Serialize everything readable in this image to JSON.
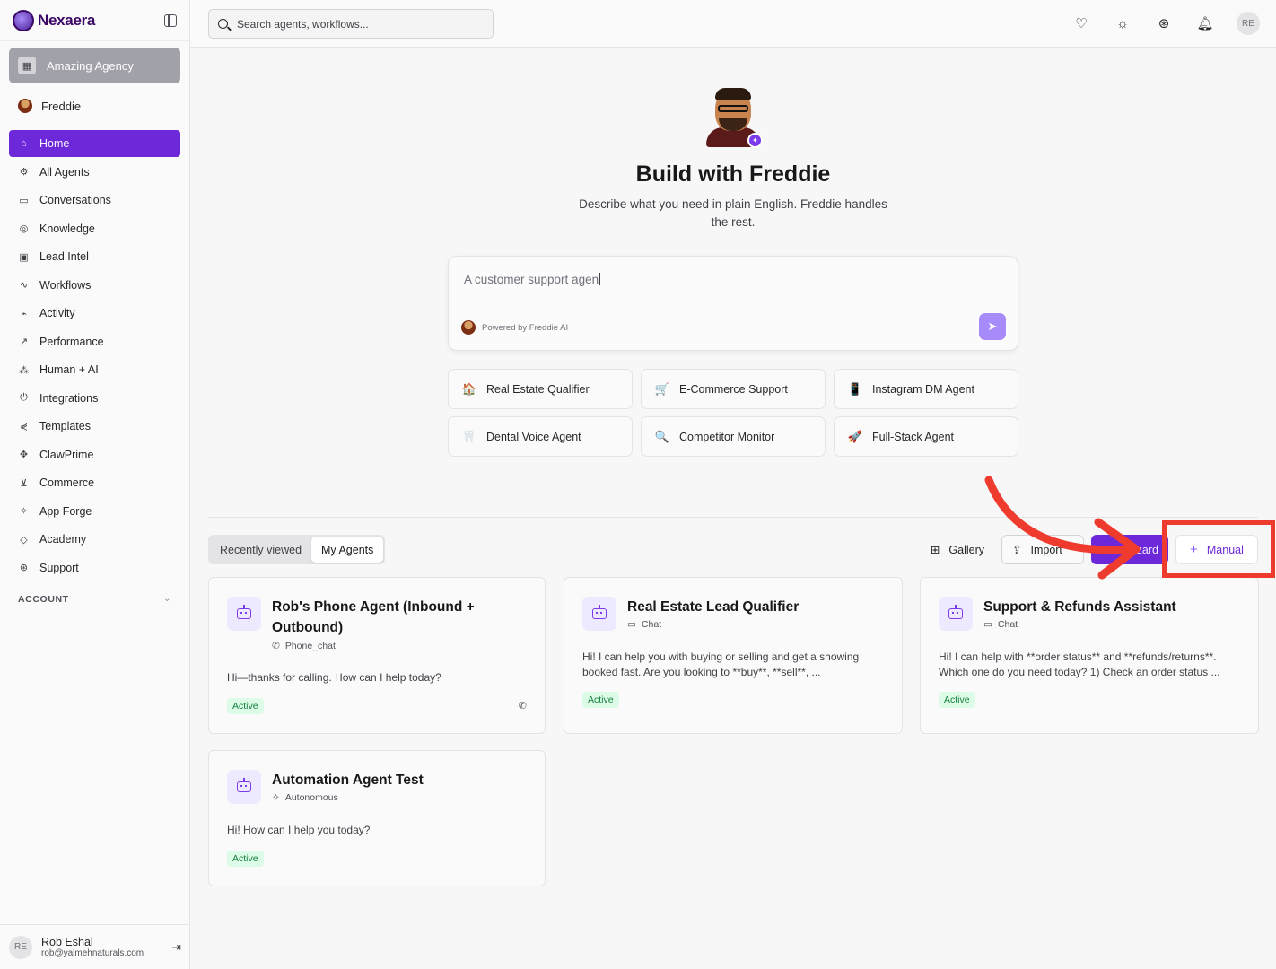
{
  "app": {
    "name": "Nexaera"
  },
  "sidebar": {
    "agency": "Amazing Agency",
    "user": "Freddie",
    "items": [
      {
        "label": "Home",
        "icon": "home-icon",
        "glyph": "⌂"
      },
      {
        "label": "All Agents",
        "icon": "robot-icon",
        "glyph": "⚙"
      },
      {
        "label": "Conversations",
        "icon": "chat-icon",
        "glyph": "▭"
      },
      {
        "label": "Knowledge",
        "icon": "brain-icon",
        "glyph": "◎"
      },
      {
        "label": "Lead Intel",
        "icon": "contact-icon",
        "glyph": "▣"
      },
      {
        "label": "Workflows",
        "icon": "workflow-icon",
        "glyph": "∿"
      },
      {
        "label": "Activity",
        "icon": "pulse-icon",
        "glyph": "⌁"
      },
      {
        "label": "Performance",
        "icon": "trend-icon",
        "glyph": "↗"
      },
      {
        "label": "Human + AI",
        "icon": "network-icon",
        "glyph": "⁂"
      },
      {
        "label": "Integrations",
        "icon": "plug-icon",
        "glyph": "⏻"
      },
      {
        "label": "Templates",
        "icon": "share-icon",
        "glyph": "⋞"
      },
      {
        "label": "ClawPrime",
        "icon": "paw-icon",
        "glyph": "✥"
      },
      {
        "label": "Commerce",
        "icon": "cart-icon",
        "glyph": "⊻"
      },
      {
        "label": "App Forge",
        "icon": "sparkles-icon",
        "glyph": "✧"
      },
      {
        "label": "Academy",
        "icon": "graduation-icon",
        "glyph": "◇"
      },
      {
        "label": "Support",
        "icon": "lifebuoy-icon",
        "glyph": "⊛"
      }
    ],
    "account_label": "ACCOUNT",
    "profile": {
      "initials": "RE",
      "name": "Rob Eshal",
      "email": "rob@yalmehnaturals.com"
    }
  },
  "topbar": {
    "search_placeholder": "Search agents, workflows...",
    "avatar_initials": "RE"
  },
  "hero": {
    "title": "Build with Freddie",
    "subtitle": "Describe what you need in plain English. Freddie handles the rest.",
    "prompt_value": "A customer support agen",
    "powered_by": "Powered by Freddie AI"
  },
  "chips": [
    {
      "label": "Real Estate Qualifier",
      "glyph": "🏠"
    },
    {
      "label": "E-Commerce Support",
      "glyph": "🛒"
    },
    {
      "label": "Instagram DM Agent",
      "glyph": "📱"
    },
    {
      "label": "Dental Voice Agent",
      "glyph": "🦷"
    },
    {
      "label": "Competitor Monitor",
      "glyph": "🔍"
    },
    {
      "label": "Full-Stack Agent",
      "glyph": "🚀"
    }
  ],
  "tabs": {
    "recent": "Recently viewed",
    "mine": "My Agents"
  },
  "actions": {
    "gallery": "Gallery",
    "import": "Import",
    "wizard": "Wizard",
    "manual": "Manual"
  },
  "cards": [
    {
      "title": "Rob's Phone Agent (Inbound + Outbound)",
      "type": "Phone_chat",
      "type_glyph": "✆",
      "desc": "Hi—thanks for calling. How can I help today?",
      "status": "Active"
    },
    {
      "title": "Real Estate Lead Qualifier",
      "type": "Chat",
      "type_glyph": "▭",
      "desc": "Hi! I can help you with buying or selling and get a showing booked fast. Are you looking to **buy**, **sell**, ...",
      "status": "Active"
    },
    {
      "title": "Support & Refunds Assistant",
      "type": "Chat",
      "type_glyph": "▭",
      "desc": "Hi! I can help with **order status** and **refunds/returns**. Which one do you need today? 1) Check an order status ...",
      "status": "Active"
    },
    {
      "title": "Automation Agent Test",
      "type": "Autonomous",
      "type_glyph": "✧",
      "desc": "Hi! How can I help you today?",
      "status": "Active"
    }
  ],
  "colors": {
    "accent": "#6d28d9",
    "highlight": "#ef3b2d",
    "active_badge": "#dcfce7"
  }
}
